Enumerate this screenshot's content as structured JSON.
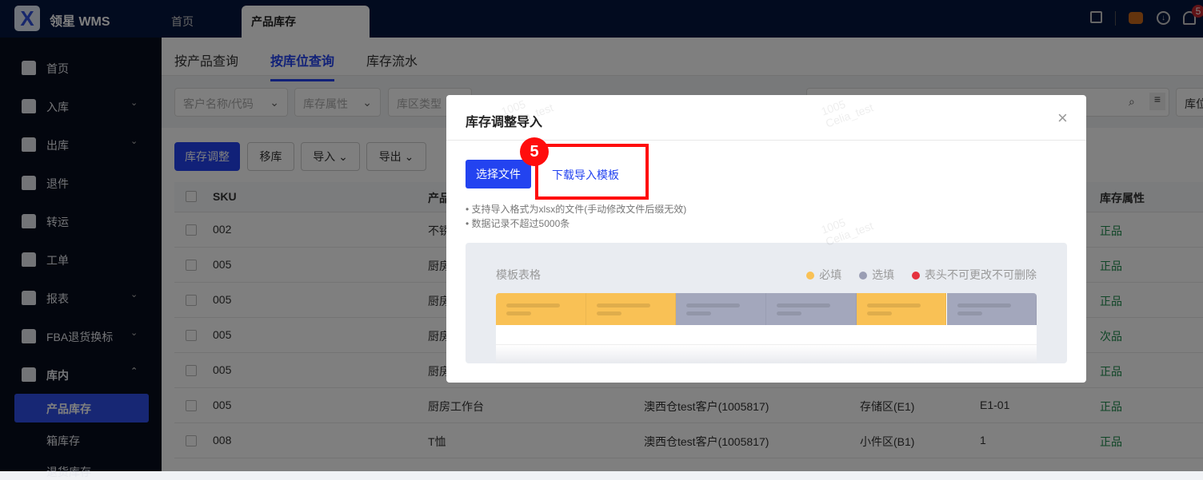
{
  "header": {
    "brand": "领星 WMS",
    "tabs": [
      "首页",
      "产品库存"
    ],
    "notification_count": "5",
    "icons": [
      "inbox-icon",
      "robot-icon",
      "download-icon",
      "bell-icon"
    ]
  },
  "sidebar": {
    "items": [
      {
        "label": "首页",
        "expand": ""
      },
      {
        "label": "入库",
        "expand": "⌄"
      },
      {
        "label": "出库",
        "expand": "⌄"
      },
      {
        "label": "退件",
        "expand": ""
      },
      {
        "label": "转运",
        "expand": ""
      },
      {
        "label": "工单",
        "expand": ""
      },
      {
        "label": "报表",
        "expand": "⌄"
      },
      {
        "label": "FBA退货换标",
        "expand": "⌄"
      },
      {
        "label": "库内",
        "expand": "⌃"
      }
    ],
    "subitems": [
      "产品库存",
      "箱库存",
      "退货库存"
    ]
  },
  "page_tabs": [
    "按产品查询",
    "按库位查询",
    "库存流水"
  ],
  "filters": {
    "customer": "客户名称/代码",
    "attr": "库存属性",
    "zone_type": "库区类型",
    "right_select": "库位"
  },
  "toolbar": {
    "adjust": "库存调整",
    "move": "移库",
    "import": "导入",
    "export": "导出"
  },
  "table": {
    "headers": [
      "SKU",
      "产品",
      "库存属性"
    ],
    "rows": [
      {
        "sku": "002",
        "name": "不锈",
        "customer": "",
        "zone": "",
        "loc": "",
        "attr": "正品"
      },
      {
        "sku": "005",
        "name": "厨房",
        "customer": "",
        "zone": "",
        "loc": "",
        "attr": "正品"
      },
      {
        "sku": "005",
        "name": "厨房",
        "customer": "",
        "zone": "",
        "loc": "",
        "attr": "正品"
      },
      {
        "sku": "005",
        "name": "厨房",
        "customer": "",
        "zone": "",
        "loc": "",
        "attr": "次品"
      },
      {
        "sku": "005",
        "name": "厨房",
        "customer": "",
        "zone": "",
        "loc": "",
        "attr": "正品"
      },
      {
        "sku": "005",
        "name": "厨房工作台",
        "customer": "澳西仓test客户(1005817)",
        "zone": "存储区(E1)",
        "loc": "E1-01",
        "attr": "正品"
      },
      {
        "sku": "008",
        "name": "T恤",
        "customer": "澳西仓test客户(1005817)",
        "zone": "小件区(B1)",
        "loc": "1",
        "attr": "正品"
      }
    ]
  },
  "modal": {
    "title": "库存调整导入",
    "select_file": "选择文件",
    "download_template": "下载导入模板",
    "step_badge": "5",
    "notes": [
      "支持导入格式为xlsx的文件(手动修改文件后缀无效)",
      "数据记录不超过5000条"
    ],
    "template_title": "模板表格",
    "legend": [
      {
        "label": "必填",
        "color": "#f9c155"
      },
      {
        "label": "选填",
        "color": "#9a9eb4"
      },
      {
        "label": "表头不可更改不可删除",
        "color": "#e5323e"
      }
    ]
  },
  "watermark": [
    "1005",
    "Celia_test"
  ],
  "colors": {
    "primary": "#2343f0",
    "success": "#1f8a4c",
    "highlight": "#ff0000"
  }
}
